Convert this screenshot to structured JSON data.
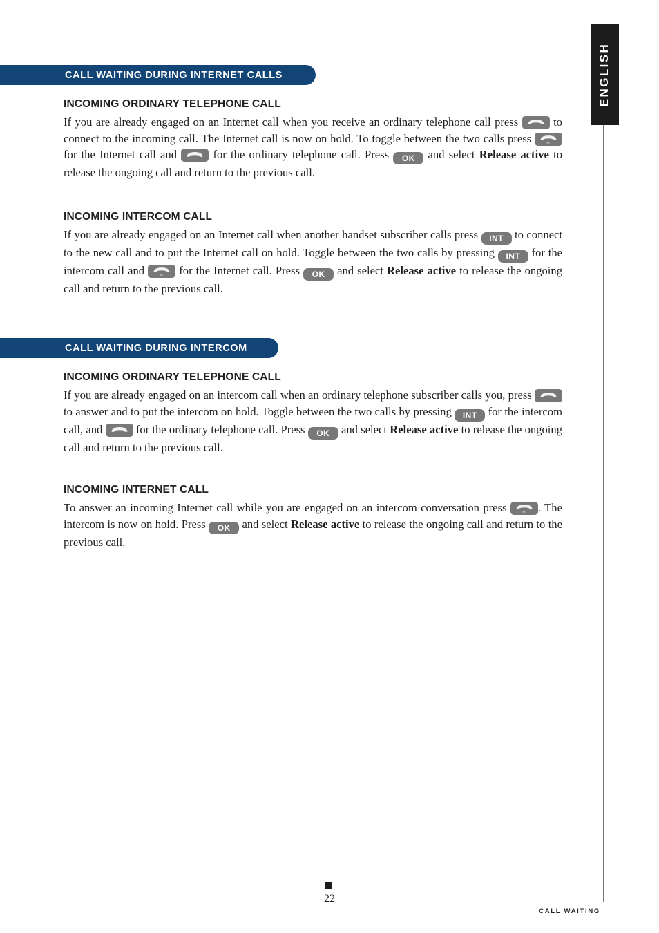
{
  "language_tab": {
    "label": "ENGLISH"
  },
  "sections": [
    {
      "bar_title": "CALL WAITING DURING INTERNET CALLS",
      "subsections": [
        {
          "heading": "INCOMING ORDINARY TELEPHONE CALL",
          "text_1": "If you are already engaged on an Internet call when you receive an ordinary telephone call press",
          "text_2": "to connect to the incoming call. The Internet call is now on hold.",
          "text_3": "To toggle between the two calls press",
          "text_4": "for the Internet call and",
          "text_5": "for the ordinary telephone call. Press",
          "text_6": "and select",
          "bold_1": "Release active",
          "text_7": "to release the ongoing call and return to the previous call."
        },
        {
          "heading": "INCOMING INTERCOM CALL",
          "text_1": "If you are already engaged on an Internet call when another handset subscriber calls press",
          "text_2": "to connect to the new call and to put the Internet call on hold. Toggle between the two calls by pressing",
          "text_3": "for the intercom call and",
          "text_4": "for the Internet call. Press",
          "text_5": "and select",
          "bold_1": "Release active",
          "text_6": "to release the ongoing call and return to the previous call."
        }
      ]
    },
    {
      "bar_title": "CALL WAITING DURING INTERCOM",
      "subsections": [
        {
          "heading": "INCOMING ORDINARY TELEPHONE CALL",
          "text_1": "If you are already engaged on an intercom call when an ordinary telephone subscriber calls you, press",
          "text_2": "to answer and to put the intercom on hold. Toggle between the two calls by pressing",
          "text_3": "for the intercom call, and",
          "text_4": "for the ordinary telephone call. Press",
          "text_5": "and select",
          "bold_1": "Release active",
          "text_6": "to release the ongoing call and return to the previous call."
        },
        {
          "heading": "INCOMING INTERNET CALL",
          "text_1": "To answer an incoming Internet call while you are engaged on an intercom conversation press",
          "text_2": ".",
          "text_3": "The intercom is now on hold. Press",
          "text_4": "and select",
          "bold_1": "Release active",
          "text_5": "to release the ongoing call and return to the previous call."
        }
      ]
    }
  ],
  "keys": {
    "ok": "OK",
    "int": "INT",
    "phone_icon": "phone-handset-icon",
    "internet_phone_icon": "internet-phone-handset-icon"
  },
  "footer": {
    "page_number": "22",
    "right_label": "CALL WAITING"
  },
  "colors": {
    "bar_navy": "#134476",
    "key_gray": "#787878",
    "tab_black": "#1c1c1c",
    "rule_gray": "#76797b"
  }
}
